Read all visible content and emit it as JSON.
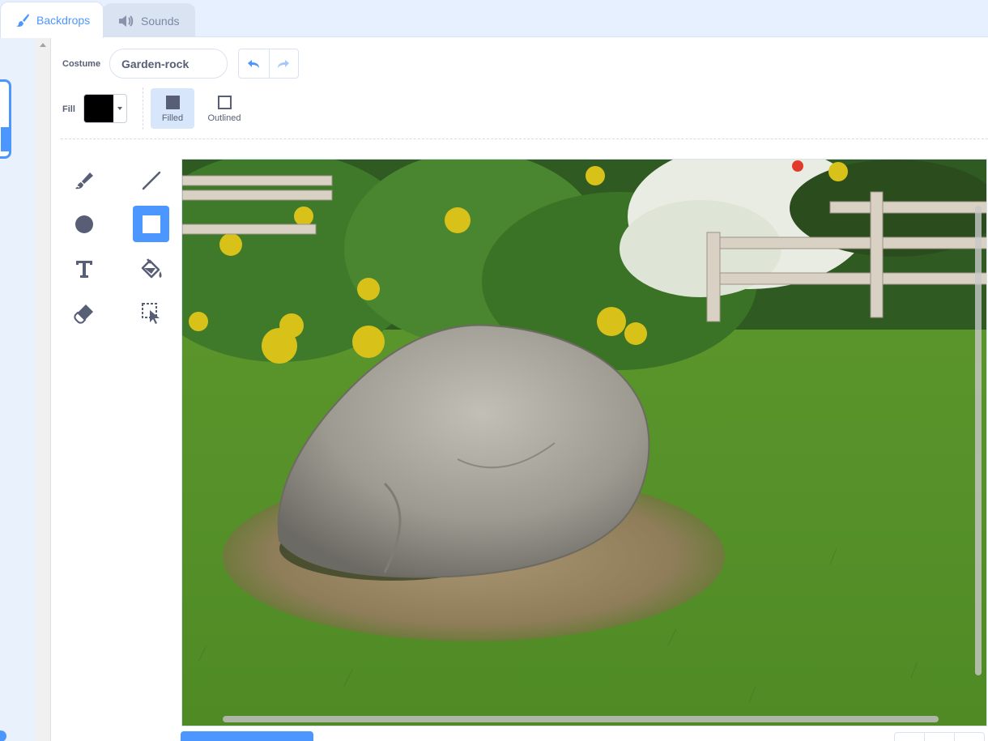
{
  "tabs": [
    {
      "label": "Backdrops",
      "icon": "paintbrush-icon",
      "active": true
    },
    {
      "label": "Sounds",
      "icon": "speaker-icon",
      "active": false
    }
  ],
  "costume": {
    "label": "Costume",
    "name": "Garden-rock"
  },
  "fill": {
    "label": "Fill",
    "color": "#000000"
  },
  "modes": {
    "filled": "Filled",
    "outlined": "Outlined",
    "selected": "filled"
  },
  "tools": [
    {
      "name": "brush",
      "icon": "brush-icon",
      "selected": false
    },
    {
      "name": "line",
      "icon": "line-icon",
      "selected": false
    },
    {
      "name": "circle",
      "icon": "circle-icon",
      "selected": false
    },
    {
      "name": "rectangle",
      "icon": "rectangle-icon",
      "selected": true
    },
    {
      "name": "text",
      "icon": "text-icon",
      "selected": false
    },
    {
      "name": "fill",
      "icon": "paint-bucket-icon",
      "selected": false
    },
    {
      "name": "eraser",
      "icon": "eraser-icon",
      "selected": false
    },
    {
      "name": "select",
      "icon": "select-icon",
      "selected": false
    }
  ],
  "colors": {
    "accent": "#4c97ff",
    "text": "#575e75",
    "tab_bg": "#e6f0ff"
  }
}
